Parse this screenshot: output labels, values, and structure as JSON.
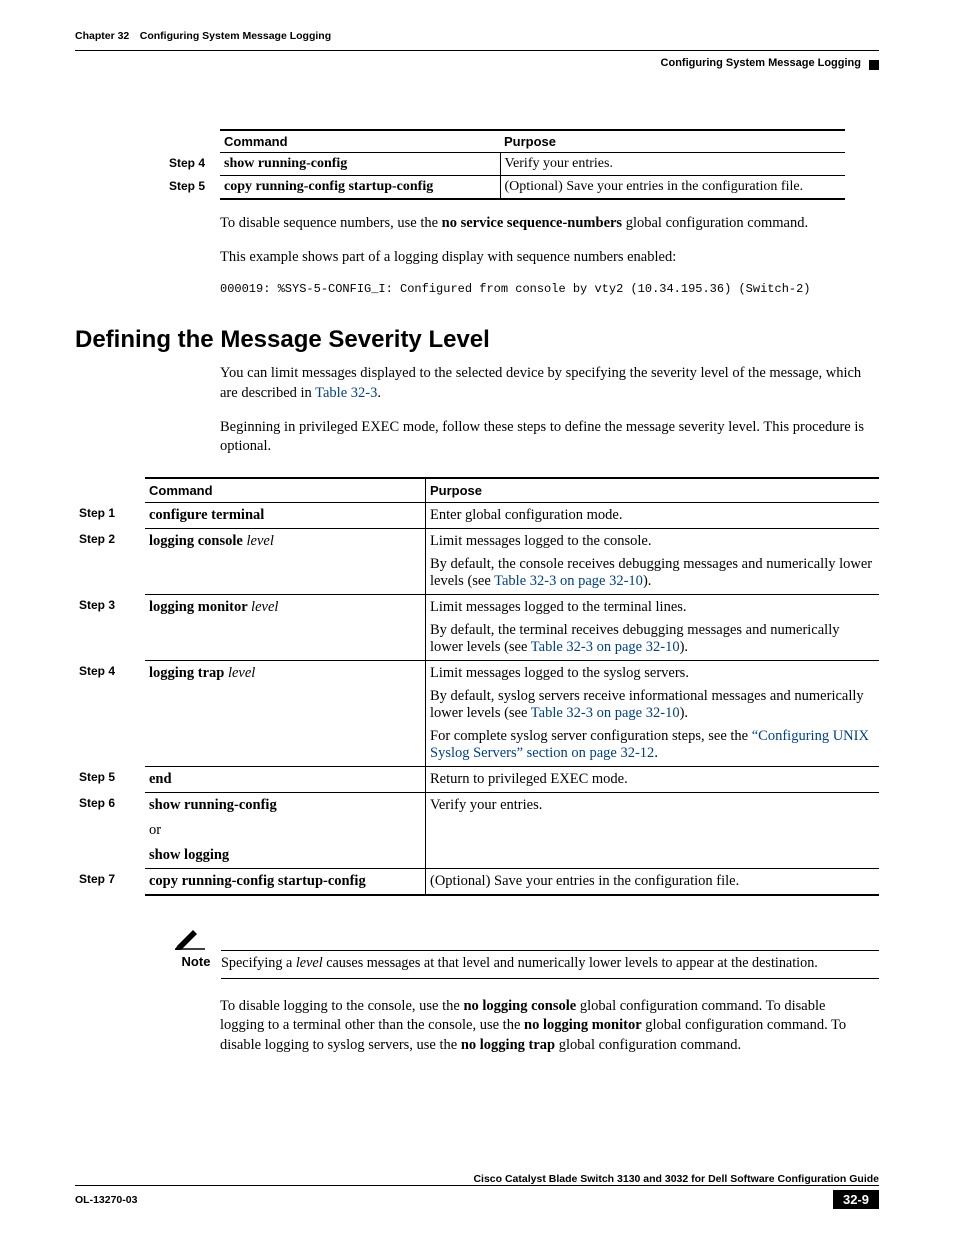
{
  "header": {
    "chapter": "Chapter 32 Configuring System Message Logging",
    "section": "Configuring System Message Logging"
  },
  "table1": {
    "headers": {
      "command": "Command",
      "purpose": "Purpose"
    },
    "rows": [
      {
        "step": "Step 4",
        "command": "show running-config",
        "purpose": "Verify your entries."
      },
      {
        "step": "Step 5",
        "command": "copy running-config startup-config",
        "purpose": "(Optional) Save your entries in the configuration file."
      }
    ]
  },
  "para1_pre": "To disable sequence numbers, use the ",
  "para1_bold": "no service sequence-numbers",
  "para1_post": " global configuration command.",
  "para2": "This example shows part of a logging display with sequence numbers enabled:",
  "code": "000019: %SYS-5-CONFIG_I: Configured from console by vty2 (10.34.195.36) (Switch-2)",
  "heading": "Defining the Message Severity Level",
  "para3_pre": "You can limit messages displayed to the selected device by specifying the severity level of the message, which are described in ",
  "para3_link": "Table 32-3",
  "para3_post": ".",
  "para4": "Beginning in privileged EXEC mode, follow these steps to define the message severity level. This procedure is optional.",
  "table2": {
    "headers": {
      "command": "Command",
      "purpose": "Purpose"
    },
    "rows": {
      "r1": {
        "step": "Step 1",
        "cmd_bold": "configure terminal",
        "purpose": "Enter global configuration mode."
      },
      "r2": {
        "step": "Step 2",
        "cmd_bold": "logging console ",
        "cmd_ital": "level",
        "p1": "Limit messages logged to the console.",
        "p2a": "By default, the console receives debugging messages and numerically lower levels (see ",
        "p2link": "Table 32-3 on page 32-10",
        "p2b": ")."
      },
      "r3": {
        "step": "Step 3",
        "cmd_bold": "logging monitor ",
        "cmd_ital": "level",
        "p1": "Limit messages logged to the terminal lines.",
        "p2a": "By default, the terminal receives debugging messages and numerically lower levels (see ",
        "p2link": "Table 32-3 on page 32-10",
        "p2b": ")."
      },
      "r4": {
        "step": "Step 4",
        "cmd_bold": "logging trap ",
        "cmd_ital": "level",
        "p1": "Limit messages logged to the syslog servers.",
        "p2a": "By default, syslog servers receive informational messages and numerically lower levels (see ",
        "p2link": "Table 32-3 on page 32-10",
        "p2b": ").",
        "p3a": "For complete syslog server configuration steps, see the ",
        "p3link": "“Configuring UNIX Syslog Servers” section on page 32-12",
        "p3b": "."
      },
      "r5": {
        "step": "Step 5",
        "cmd_bold": "end",
        "purpose": "Return to privileged EXEC mode."
      },
      "r6": {
        "step": "Step 6",
        "cmd_bold1": "show running-config",
        "or": "or",
        "cmd_bold2": "show logging",
        "purpose": "Verify your entries."
      },
      "r7": {
        "step": "Step 7",
        "cmd_bold": "copy running-config startup-config",
        "purpose": "(Optional) Save your entries in the configuration file."
      }
    }
  },
  "note": {
    "label": "Note",
    "text_pre": "Specifying a ",
    "text_ital": "level",
    "text_post": " causes messages at that level and numerically lower levels to appear at the destination."
  },
  "para5_a": "To disable logging to the console, use the ",
  "para5_b1": "no logging console",
  "para5_c": " global configuration command. To disable logging to a terminal other than the console, use the ",
  "para5_b2": "no logging monitor",
  "para5_d": " global configuration command. To disable logging to syslog servers, use the ",
  "para5_b3": "no logging trap",
  "para5_e": " global configuration command.",
  "footer": {
    "title": "Cisco Catalyst Blade Switch 3130 and 3032 for Dell Software Configuration Guide",
    "doc": "OL-13270-03",
    "page": "32-9"
  },
  "chart_data": null
}
